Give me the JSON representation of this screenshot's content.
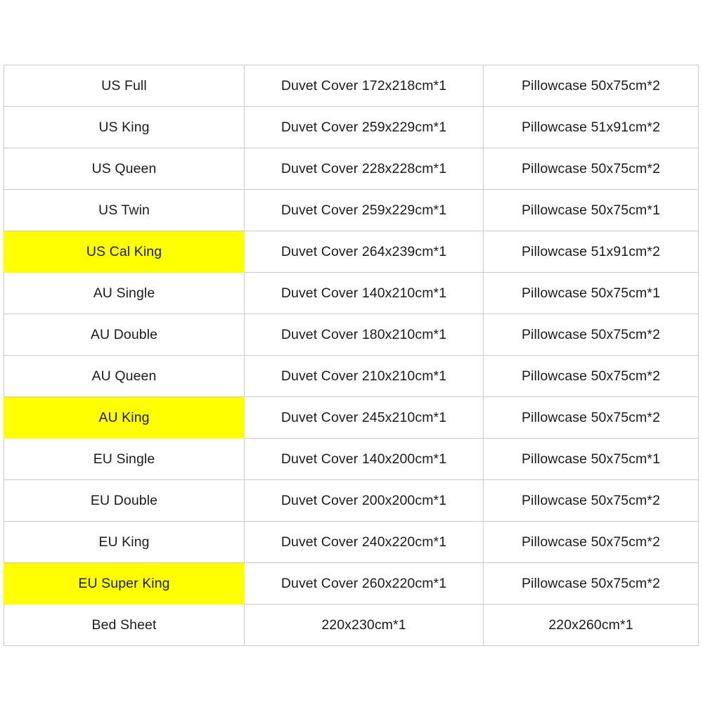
{
  "table": {
    "columns": [
      "size",
      "duvet_cover",
      "pillowcase"
    ],
    "highlight_color": "#FFFF00",
    "border_color": "#C9CACC",
    "text_color": "#1B1B1B",
    "background_color": "#FFFFFF",
    "rows": [
      {
        "size": "US Full",
        "duvet_cover": "Duvet Cover 172x218cm*1",
        "pillowcase": "Pillowcase 50x75cm*2",
        "highlighted": false
      },
      {
        "size": "US King",
        "duvet_cover": "Duvet Cover 259x229cm*1",
        "pillowcase": "Pillowcase 51x91cm*2",
        "highlighted": false
      },
      {
        "size": "US Queen",
        "duvet_cover": "Duvet Cover 228x228cm*1",
        "pillowcase": "Pillowcase 50x75cm*2",
        "highlighted": false
      },
      {
        "size": "US Twin",
        "duvet_cover": "Duvet Cover 259x229cm*1",
        "pillowcase": "Pillowcase 50x75cm*1",
        "highlighted": false
      },
      {
        "size": "US Cal King",
        "duvet_cover": "Duvet Cover 264x239cm*1",
        "pillowcase": "Pillowcase 51x91cm*2",
        "highlighted": true
      },
      {
        "size": "AU Single",
        "duvet_cover": "Duvet Cover 140x210cm*1",
        "pillowcase": "Pillowcase 50x75cm*1",
        "highlighted": false
      },
      {
        "size": "AU Double",
        "duvet_cover": "Duvet Cover 180x210cm*1",
        "pillowcase": "Pillowcase 50x75cm*2",
        "highlighted": false
      },
      {
        "size": "AU Queen",
        "duvet_cover": "Duvet Cover 210x210cm*1",
        "pillowcase": "Pillowcase 50x75cm*2",
        "highlighted": false
      },
      {
        "size": "AU King",
        "duvet_cover": "Duvet Cover 245x210cm*1",
        "pillowcase": "Pillowcase 50x75cm*2",
        "highlighted": true
      },
      {
        "size": "EU Single",
        "duvet_cover": "Duvet Cover 140x200cm*1",
        "pillowcase": "Pillowcase 50x75cm*1",
        "highlighted": false
      },
      {
        "size": "EU Double",
        "duvet_cover": "Duvet Cover 200x200cm*1",
        "pillowcase": "Pillowcase 50x75cm*2",
        "highlighted": false
      },
      {
        "size": "EU King",
        "duvet_cover": "Duvet Cover 240x220cm*1",
        "pillowcase": "Pillowcase 50x75cm*2",
        "highlighted": false
      },
      {
        "size": "EU Super King",
        "duvet_cover": "Duvet Cover 260x220cm*1",
        "pillowcase": "Pillowcase 50x75cm*2",
        "highlighted": true
      },
      {
        "size": "Bed Sheet",
        "duvet_cover": "220x230cm*1",
        "pillowcase": "220x260cm*1",
        "highlighted": false
      }
    ]
  }
}
